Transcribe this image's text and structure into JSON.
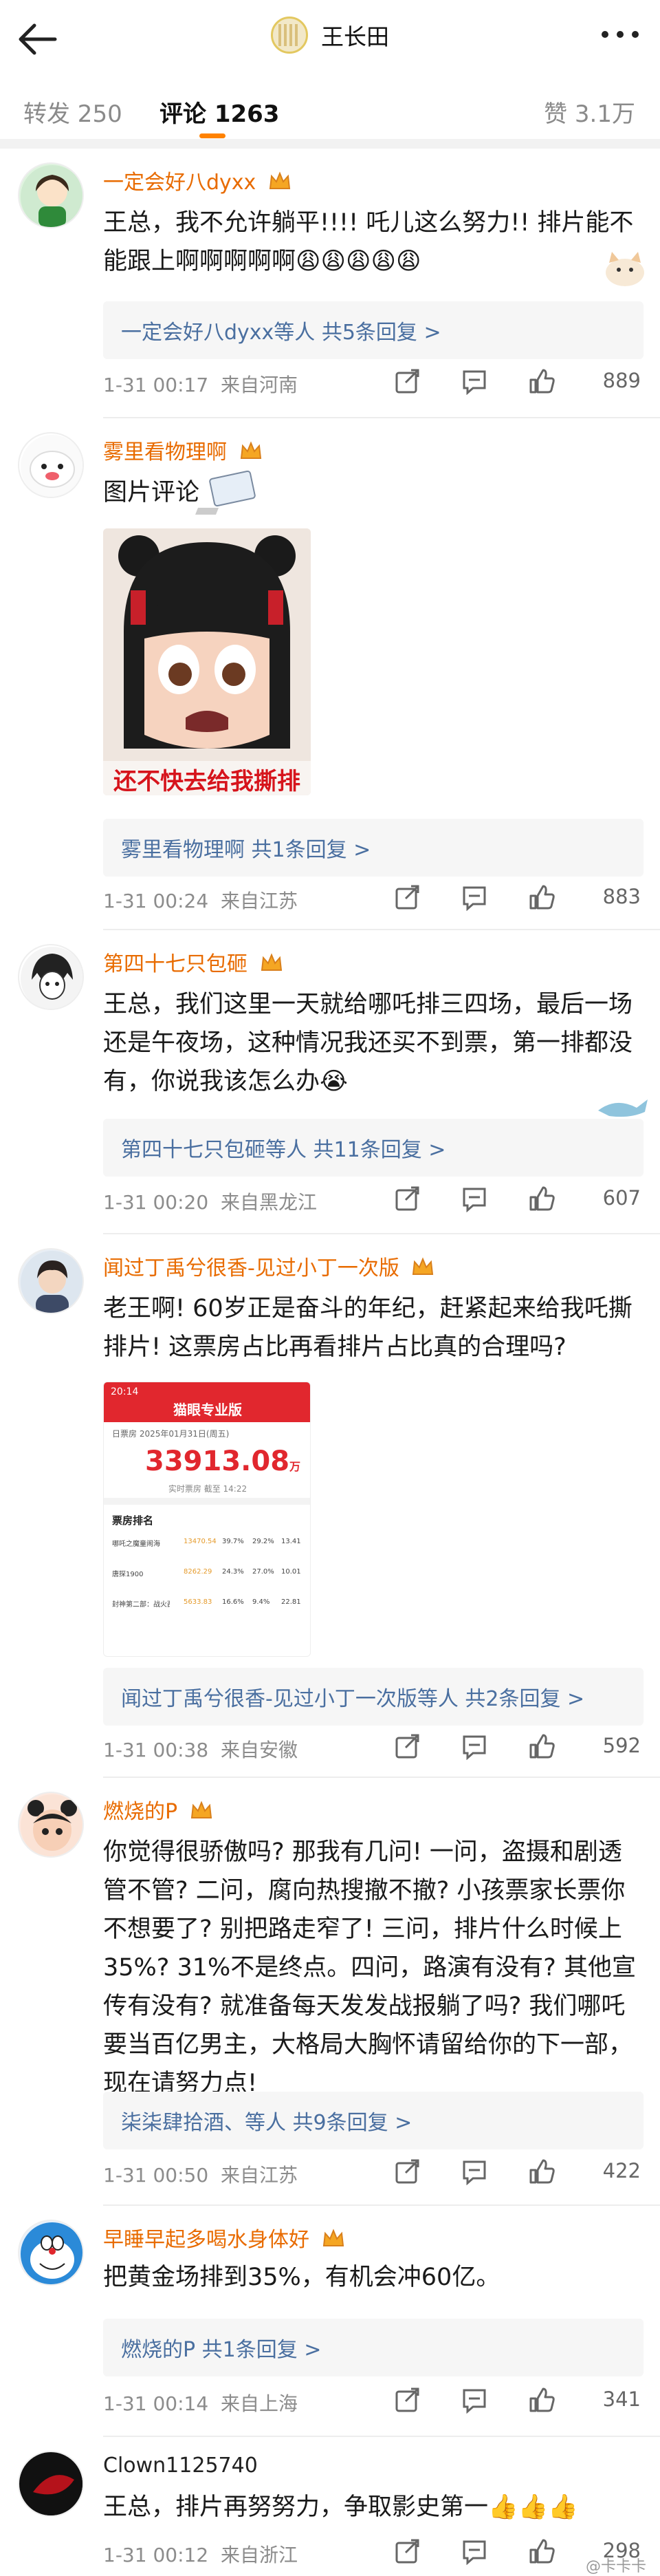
{
  "header": {
    "title": "王长田",
    "back_icon": "back-arrow-icon",
    "more_icon": "more-dots-icon"
  },
  "tabs": [
    {
      "label": "转发 250"
    },
    {
      "label": "评论 1263"
    },
    {
      "label": "赞 3.1万"
    }
  ],
  "comments": [
    {
      "user": "一定会好八dyxx",
      "text": "王总，我不允许躺平!!!! 吒儿这么努力!! 排片能不能跟上啊啊啊啊啊😩😩😩😩😩",
      "replies": "一定会好八dyxx等人  共5条回复 >",
      "time": "1-31 00:17",
      "location": "来自河南",
      "likes": "889"
    },
    {
      "user": "雾里看物理啊",
      "text": "图片评论",
      "image_caption": "还不快去给我撕排片",
      "replies": "雾里看物理啊  共1条回复 >",
      "time": "1-31 00:24",
      "location": "来自江苏",
      "likes": "883"
    },
    {
      "user": "第四十七只包砸",
      "text": "王总，我们这里一天就给哪吒排三四场，最后一场还是午夜场，这种情况我还买不到票，第一排都没有，你说我该怎么办😭",
      "replies": "第四十七只包砸等人  共11条回复 >",
      "time": "1-31 00:20",
      "location": "来自黑龙江",
      "likes": "607"
    },
    {
      "user": "闻过丁禹兮很香-见过小丁一次版",
      "text": "老王啊! 60岁正是奋斗的年纪，赶紧起来给我吒撕排片! 这票房占比再看排片占比真的合理吗?",
      "replies": "闻过丁禹兮很香-见过小丁一次版等人  共2条回复 >",
      "time": "1-31 00:38",
      "location": "来自安徽",
      "likes": "592",
      "shot": {
        "time": "20:14",
        "app": "猫眼专业版",
        "date_line": "日票房  2025年01月31日(周五)",
        "total": "33913.08",
        "unit": "万",
        "sub": "实时票房  截至 14:22",
        "section": "票房排名",
        "rows": [
          {
            "name": "哪吒之魔童闹海",
            "a": "13470.54",
            "b": "39.7%",
            "c": "29.2%",
            "d": "13.41"
          },
          {
            "name": "唐探1900",
            "a": "8262.29",
            "b": "24.3%",
            "c": "27.0%",
            "d": "10.01"
          },
          {
            "name": "封神第二部：战火西岐",
            "a": "5633.83",
            "b": "16.6%",
            "c": "9.4%",
            "d": "22.81"
          }
        ]
      }
    },
    {
      "user": "燃烧的P",
      "text": "你觉得很骄傲吗? 那我有几问! 一问，盗摄和剧透管不管? 二问，腐向热搜撤不撤? 小孩票家长票你不想要了? 别把路走窄了! 三问，排片什么时候上35%? 31%不是终点。四问，路演有没有? 其他宣传有没有? 就准备每天发发战报躺了吗? 我们哪吒要当百亿男主，大格局大胸怀请留给你的下一部，现在请努力点!",
      "replies": "柒柒肆拾酒、等人  共9条回复 >",
      "time": "1-31 00:50",
      "location": "来自江苏",
      "likes": "422"
    },
    {
      "user": "早睡早起多喝水身体好",
      "text": "把黄金场排到35%，有机会冲60亿。",
      "replies": "燃烧的P  共1条回复 >",
      "time": "1-31 00:14",
      "location": "来自上海",
      "likes": "341"
    },
    {
      "user": "Clown1125740",
      "text": "王总，排片再努努力，争取影史第一👍👍👍",
      "time": "1-31 00:12",
      "location": "来自浙江",
      "likes": "298"
    }
  ],
  "watermark": "@卡卡卡",
  "colors": {
    "accent": "#ff8200",
    "username": "#e86b00",
    "reply_link": "#4a6fa0"
  }
}
